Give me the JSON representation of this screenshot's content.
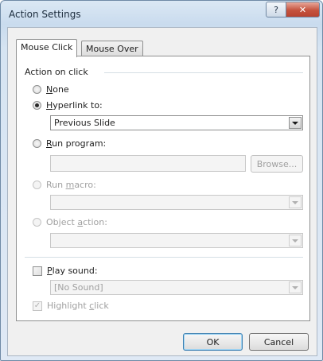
{
  "window": {
    "title": "Action Settings",
    "help_glyph": "?",
    "close_glyph": "✕"
  },
  "tabs": [
    {
      "label": "Mouse Click",
      "active": true
    },
    {
      "label": "Mouse Over",
      "active": false
    }
  ],
  "group": {
    "label": "Action on click"
  },
  "options": {
    "none": {
      "label_u": "N",
      "label_rest": "one"
    },
    "hyperlink": {
      "label_u": "H",
      "label_rest": "yperlink to:",
      "value": "Previous Slide"
    },
    "run_program": {
      "label_u": "R",
      "label_rest": "un program:",
      "browse": "Browse..."
    },
    "run_macro": {
      "label_pre": "Run ",
      "label_u": "m",
      "label_rest": "acro:"
    },
    "object_action": {
      "label_pre": "Object ",
      "label_u": "a",
      "label_rest": "ction:"
    }
  },
  "sound": {
    "label_u": "P",
    "label_rest": "lay sound:",
    "value": "[No Sound]"
  },
  "highlight": {
    "label_pre": "Highlight ",
    "label_u": "c",
    "label_rest": "lick",
    "checkmark": "✓"
  },
  "footer": {
    "ok": "OK",
    "cancel": "Cancel"
  }
}
